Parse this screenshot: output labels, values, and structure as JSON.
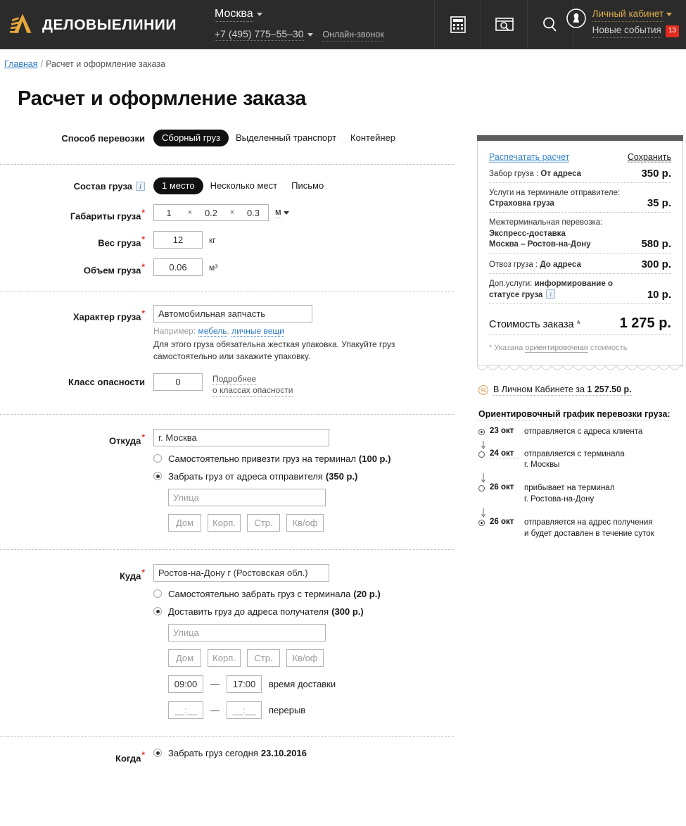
{
  "header": {
    "logo_text": "ДЕЛОВЫЕЛИНИИ",
    "city": "Москва",
    "phone": "+7 (495) 775–55–30",
    "online_call": "Онлайн-звонок",
    "icons": [
      "calculator-icon",
      "tracking-icon",
      "search-icon",
      "user-icon"
    ],
    "account_top": "Личный кабинет",
    "account_bottom": "Новые события",
    "account_badge": "13"
  },
  "breadcrumb": {
    "home": "Главная",
    "separator": "/",
    "current": "Расчет и оформление заказа"
  },
  "page_title": "Расчет и оформление заказа",
  "form": {
    "shipping_method": {
      "label": "Способ перевозки",
      "options": [
        "Сборный груз",
        "Выделенный транспорт",
        "Контейнер"
      ],
      "selected": "Сборный груз"
    },
    "cargo_composition": {
      "label": "Состав груза",
      "options": [
        "1 место",
        "Несколько мест",
        "Письмо"
      ],
      "selected": "1 место"
    },
    "dimensions": {
      "label": "Габариты груза",
      "length": "1",
      "width": "0.2",
      "height": "0.3",
      "x_sign": "×",
      "unit": "м"
    },
    "weight": {
      "label": "Вес груза",
      "value": "12",
      "unit": "кг"
    },
    "volume": {
      "label": "Объем груза",
      "value": "0.06",
      "unit": "м³"
    },
    "cargo_type": {
      "label": "Характер груза",
      "value": "Автомобильная запчасть",
      "example_prefix": "Например:",
      "example_links": [
        "мебель",
        "личные вещи"
      ],
      "note": "Для этого груза обязательна жесткая упаковка. Упакуйте груз самостоятельно или закажите упаковку."
    },
    "danger_class": {
      "label": "Класс опасности",
      "value": "0",
      "link_line1": "Подробнее",
      "link_line2": "о классах опасности"
    },
    "from": {
      "label": "Откуда",
      "city": "г. Москва",
      "option_self": "Самостоятельно привезти груз на терминал",
      "option_self_price": "(100 р.)",
      "option_pickup": "Забрать груз от адреса отправителя",
      "option_pickup_price": "(350 р.)",
      "selected": "pickup",
      "street_placeholder": "Улица",
      "house_placeholder": "Дом",
      "building_placeholder": "Корп.",
      "structure_placeholder": "Стр.",
      "apartment_placeholder": "Кв/оф"
    },
    "to": {
      "label": "Куда",
      "city": "Ростов-на-Дону г (Ростовская обл.)",
      "option_self": "Самостоятельно забрать груз с терминала",
      "option_self_price": "(20 р.)",
      "option_deliver": "Доставить груз до адреса получателя",
      "option_deliver_price": "(300 р.)",
      "selected": "deliver",
      "street_placeholder": "Улица",
      "house_placeholder": "Дом",
      "building_placeholder": "Корп.",
      "structure_placeholder": "Стр.",
      "apartment_placeholder": "Кв/оф",
      "delivery_time_from": "09:00",
      "delivery_time_to": "17:00",
      "delivery_time_label": "время доставки",
      "break_from": "",
      "break_to": "",
      "break_placeholder": "__:__",
      "break_label": "перерыв"
    },
    "when": {
      "label": "Когда",
      "option_today": "Забрать груз сегодня",
      "today_date": "23.10.2016"
    }
  },
  "calc_panel": {
    "print_link": "Распечатать расчет",
    "save_link": "Сохранить",
    "lines": [
      {
        "text_plain": "Забор груза : ",
        "text_bold": "От адреса",
        "second_line": "",
        "price": "350 р."
      },
      {
        "text_plain": "Услуги на терминале отправителе:",
        "text_bold": "",
        "second_line": "Страховка груза",
        "price": "35 р."
      },
      {
        "text_plain": "Межтерминальная перевозка:",
        "text_bold": "",
        "second_line": "Экспресс-доставка",
        "third_line": "Москва – Ростов-на-Дону",
        "price": "580 р."
      },
      {
        "text_plain": "Отвоз груза : ",
        "text_bold": "До адреса",
        "second_line": "",
        "price": "300 р."
      },
      {
        "text_plain": "Доп.услуги: ",
        "text_bold": "информирование о",
        "second_line": "статусе груза",
        "has_info_icon": true,
        "price": "10 р."
      }
    ],
    "total_label": "Стоимость заказа",
    "total_star": "*",
    "total_price": "1 275 р.",
    "footnote_pre": "* Указана ",
    "footnote_link": "ориентировочная",
    "footnote_post": " стоимость"
  },
  "lk_offer": {
    "icon": "percent-icon",
    "text_pre": "В Личном Кабинете за ",
    "text_bold": "1 257.50 р."
  },
  "schedule": {
    "title": "Ориентировочный график перевозки груза:",
    "items": [
      {
        "date": "23 окт",
        "desc": "отправляется с адреса клиента",
        "desc2": "",
        "filled": true,
        "date_dotted": false
      },
      {
        "date": "24 окт",
        "desc": "отправляется с терминала",
        "desc2": "г. Москвы",
        "filled": false,
        "date_dotted": true
      },
      {
        "date": "26 окт",
        "desc": "прибывает на терминал",
        "desc2": "г. Ростова-на-Дону",
        "filled": false,
        "date_dotted": false
      },
      {
        "date": "26 окт",
        "desc": "отправляется на адрес получения",
        "desc2": "и будет доставлен в течение суток",
        "filled": true,
        "date_dotted": false
      }
    ]
  },
  "colors": {
    "header_bg": "#2b2b2b",
    "accent_gold": "#e3a93a",
    "link_blue": "#2a79c4",
    "badge_red": "#e02b20",
    "panel_bar": "#5d5d5d"
  }
}
